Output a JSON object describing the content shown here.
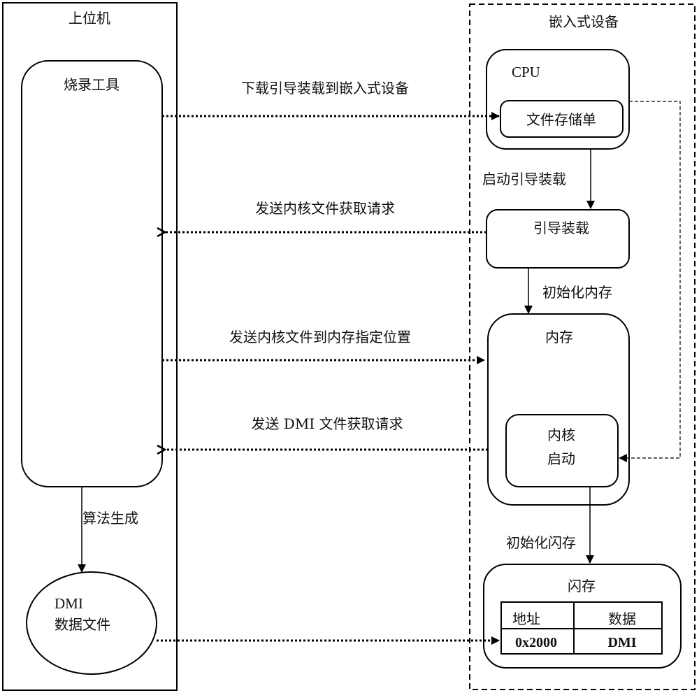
{
  "host": {
    "title": "上位机",
    "burn_tool": {
      "label": "烧录工具"
    },
    "algo_edge": {
      "label": "算法生成"
    },
    "dmi_file": {
      "line1": "DMI",
      "line2": "数据文件"
    }
  },
  "device": {
    "title": "嵌入式设备",
    "cpu": {
      "label": "CPU",
      "file_store": "文件存储单"
    },
    "start_boot_edge": {
      "label": "启动引导装载"
    },
    "bootloader": {
      "label": "引导装载"
    },
    "init_mem_edge": {
      "label": "初始化内存"
    },
    "memory": {
      "label": "内存",
      "kernel_line1": "内核",
      "kernel_line2": "启动"
    },
    "init_flash_edge": {
      "label": "初始化闪存"
    },
    "flash": {
      "label": "闪存",
      "table": {
        "headers": [
          "地址",
          "数据"
        ],
        "rows": [
          [
            "0x2000",
            "DMI"
          ]
        ]
      }
    }
  },
  "messages": [
    {
      "label": "下载引导装载到嵌入式设备",
      "direction": "right"
    },
    {
      "label": "发送内核文件获取请求",
      "direction": "left"
    },
    {
      "label": "发送内核文件到内存指定位置",
      "direction": "right"
    },
    {
      "label": "发送 DMI 文件获取请求",
      "direction": "left"
    },
    {
      "label": "",
      "direction": "right"
    }
  ]
}
